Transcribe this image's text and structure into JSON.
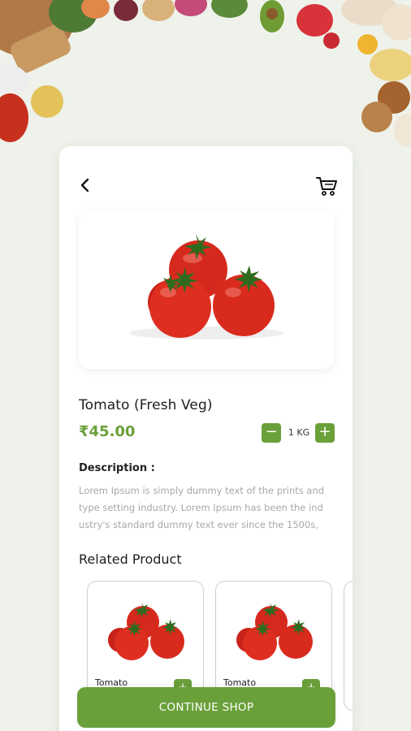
{
  "header": {
    "back_icon": "chevron-left-icon",
    "cart_icon": "shopping-cart-icon"
  },
  "product": {
    "name": "Tomato (Fresh Veg)",
    "price": "₹45.00",
    "quantity": "1 KG",
    "minus_label": "−",
    "plus_label": "+"
  },
  "description": {
    "title": "Description :",
    "text": "Lorem Ipsum is simply dummy text of the prints and type setting industry. Lorem Ipsum has been the ind ustry's standard dummy text ever since the 1500s,"
  },
  "related": {
    "title": "Related Product",
    "items": [
      {
        "name": "Tomato",
        "add_label": "+"
      },
      {
        "name": "Tomato",
        "add_label": "+"
      }
    ]
  },
  "footer": {
    "continue_label": "CONTINUE SHOP"
  },
  "colors": {
    "accent": "#6aa03a",
    "background": "#eef2ea",
    "tomato": "#d6291d"
  }
}
